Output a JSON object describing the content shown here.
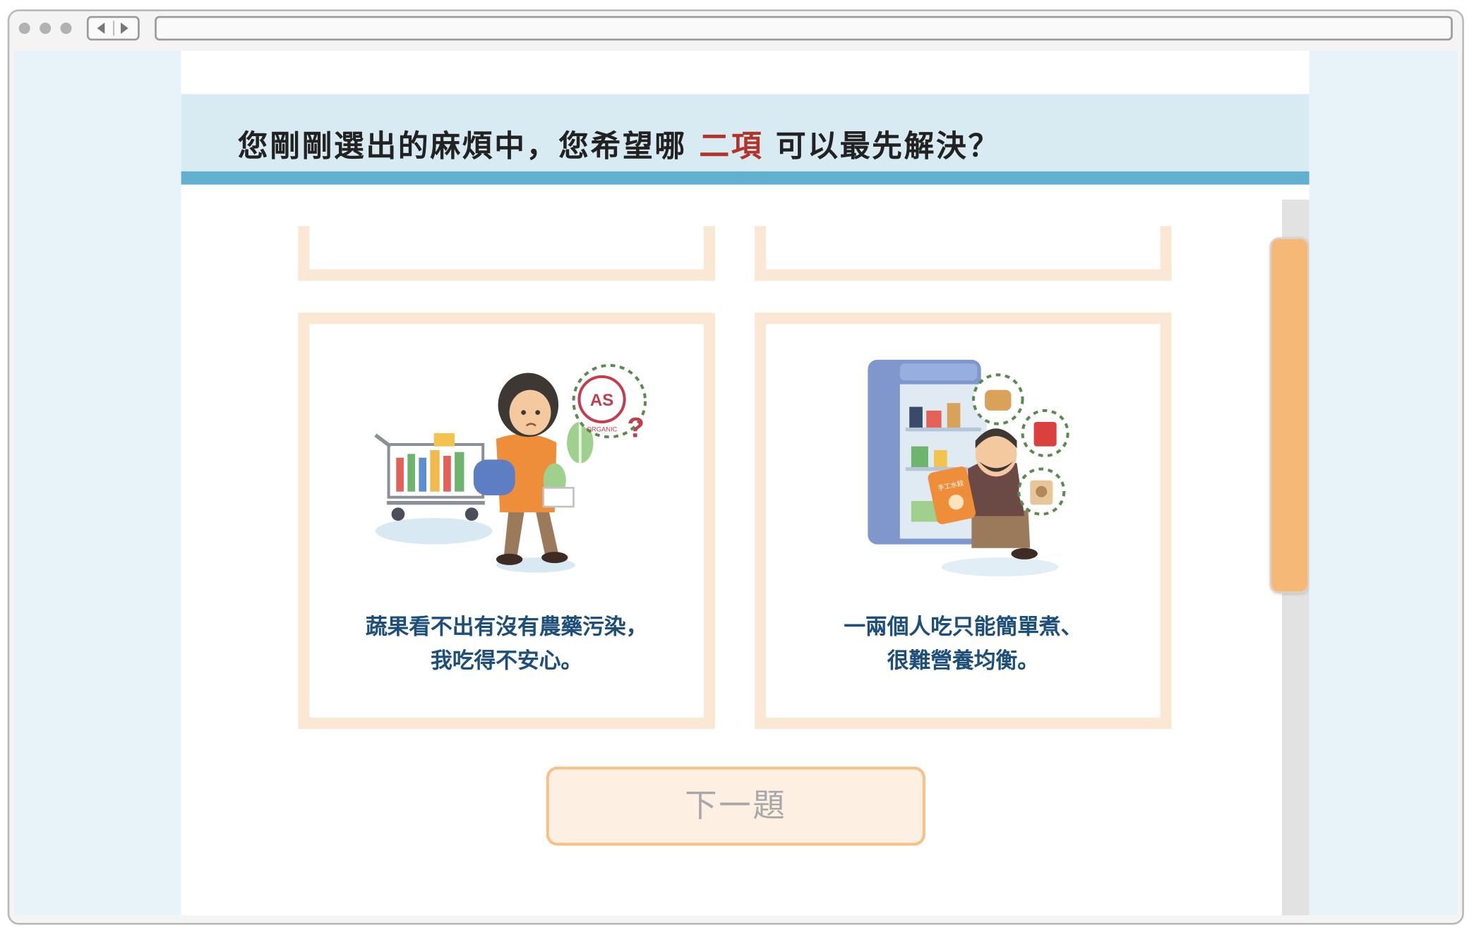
{
  "browser": {
    "url": ""
  },
  "question": {
    "prefix": "您剛剛選出的麻煩中，您希望哪",
    "highlight": "二項",
    "suffix": "可以最先解決？"
  },
  "options": [
    {
      "line1": "蔬果看不出有沒有農藥污染，",
      "line2": "我吃得不安心。",
      "badge_label": "AS",
      "badge_sub": "ORGANIC"
    },
    {
      "line1": "一兩個人吃只能簡單煮、",
      "line2": "很難營養均衡。",
      "package_label": "手工水餃"
    }
  ],
  "next_button": {
    "label": "下一題"
  },
  "colors": {
    "header_bg": "#d8eaf2",
    "header_bar": "#62b0cf",
    "highlight": "#b3332a",
    "card_border": "#fbe8d4",
    "caption": "#1e4f7a",
    "scroll_thumb": "#f5b877"
  }
}
